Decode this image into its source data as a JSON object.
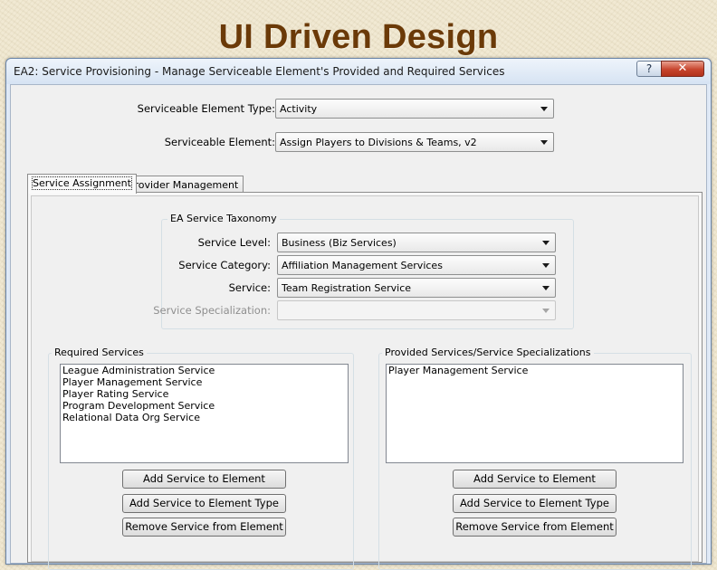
{
  "slide": {
    "title": "UI Driven Design"
  },
  "window": {
    "title": "EA2: Service Provisioning - Manage Serviceable Element's Provided and Required Services",
    "help_label": "?",
    "close_label": "✕"
  },
  "top_fields": {
    "element_type_label": "Serviceable Element Type:",
    "element_type_value": "Activity",
    "element_label": "Serviceable Element:",
    "element_value": "Assign Players to Divisions & Teams, v2"
  },
  "tabs": [
    {
      "label": "Service Assignment",
      "active": true
    },
    {
      "label": "Provider Management",
      "active": false
    }
  ],
  "taxonomy": {
    "caption": "EA Service Taxonomy",
    "level_label": "Service Level:",
    "level_value": "Business (Biz Services)",
    "category_label": "Service Category:",
    "category_value": "Affiliation Management Services",
    "service_label": "Service:",
    "service_value": "Team Registration Service",
    "specialization_label": "Service Specialization:",
    "specialization_value": ""
  },
  "required": {
    "caption": "Required Services",
    "items": [
      "League Administration Service",
      "Player Management Service",
      "Player Rating Service",
      "Program Development Service",
      "Relational Data Org Service"
    ],
    "buttons": [
      "Add Service to Element",
      "Add Service to Element Type",
      "Remove Service from Element"
    ]
  },
  "provided": {
    "caption": "Provided Services/Service Specializations",
    "items": [
      "Player Management Service"
    ],
    "buttons": [
      "Add Service to Element",
      "Add Service to Element Type",
      "Remove Service from Element"
    ]
  }
}
